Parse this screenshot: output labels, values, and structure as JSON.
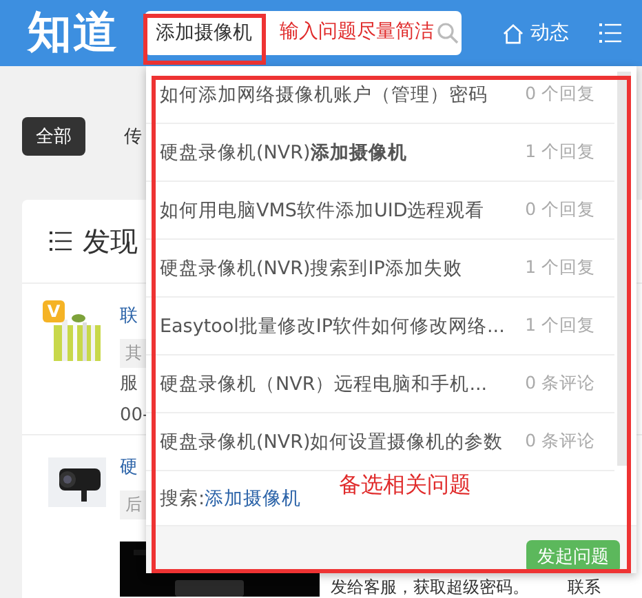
{
  "header": {
    "logo": "知道",
    "search": {
      "value": "添加摄像机"
    },
    "nav": [
      {
        "label": "动态"
      }
    ]
  },
  "annotations": [
    {
      "text": "输入问题尽量简洁"
    },
    {
      "text": "备选相关问题"
    }
  ],
  "filters": [
    {
      "label": "全部",
      "selected": true
    },
    {
      "label": "传",
      "selected": false
    }
  ],
  "card": {
    "title": "发现",
    "items": [
      {
        "title": "联",
        "tag": "其",
        "lines": [
          "服",
          "00-"
        ],
        "badge": "V"
      },
      {
        "title": "硬",
        "tag": "后",
        "excerpt": "发给客服，获取超级密码。",
        "extra": "联系"
      }
    ]
  },
  "suggestions": {
    "items": [
      {
        "title": "如何添加网络摄像机账户（管理）密码",
        "count": "0 个回复"
      },
      {
        "title": "硬盘录像机(NVR)**添加摄像机**",
        "count": "1 个回复"
      },
      {
        "title": "如何用电脑VMS软件添加UID选程观看",
        "count": "0 个回复"
      },
      {
        "title": "硬盘录像机(NVR)搜索到IP添加失败",
        "count": "1 个回复"
      },
      {
        "title": "Easytool批量修改IP软件如何修改网络...",
        "count": "1 个回复"
      },
      {
        "title": "硬盘录像机（NVR）远程电脑和手机...",
        "count": "0 条评论"
      },
      {
        "title": "硬盘录像机(NVR)如何设置摄像机的参数",
        "count": "0 条评论"
      }
    ],
    "search_label": "搜索:",
    "search_term": "添加摄像机",
    "ask_button": "发起问题"
  }
}
